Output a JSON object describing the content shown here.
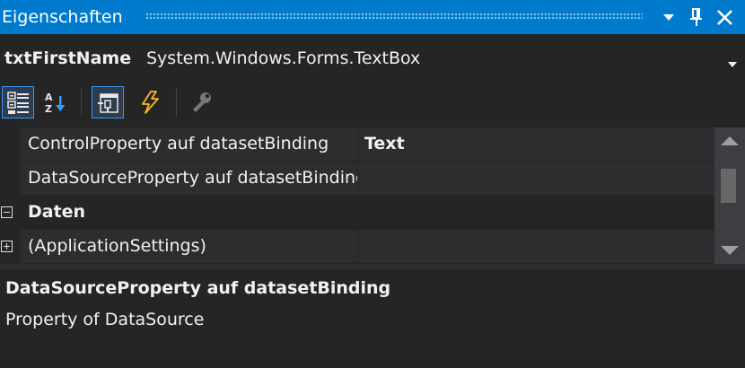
{
  "titlebar": {
    "title": "Eigenschaften",
    "icons": [
      "window-position-chevron-icon",
      "pin-icon",
      "close-icon"
    ],
    "color": "#007acc"
  },
  "object_selector": {
    "name": "txtFirstName",
    "type": "System.Windows.Forms.TextBox",
    "icon": "dropdown-arrow-icon"
  },
  "toolbar": {
    "buttons": [
      {
        "icon": "categorized-icon",
        "active": true
      },
      {
        "icon": "alphabetical-icon",
        "active": false
      },
      {
        "icon": "properties-icon",
        "active": true
      },
      {
        "icon": "events-lightning-icon",
        "active": false
      },
      {
        "icon": "property-pages-wrench-icon",
        "active": false
      }
    ]
  },
  "grid": {
    "rows": [
      {
        "type": "property",
        "name": "ControlProperty auf datasetBinding",
        "value": "Text"
      },
      {
        "type": "property",
        "name": "DataSourceProperty auf datasetBinding",
        "value": ""
      },
      {
        "type": "category",
        "name": "Daten",
        "expanded": true
      },
      {
        "type": "property",
        "name": "(ApplicationSettings)",
        "value": "",
        "expandable": true,
        "expanded": false
      }
    ]
  },
  "description": {
    "title": "DataSourceProperty auf datasetBinding",
    "text": "Property of DataSource"
  },
  "colors": {
    "background": "#252526",
    "cell": "#2d2d30",
    "accent": "#007acc",
    "scrollbar": "#3e3e42"
  }
}
